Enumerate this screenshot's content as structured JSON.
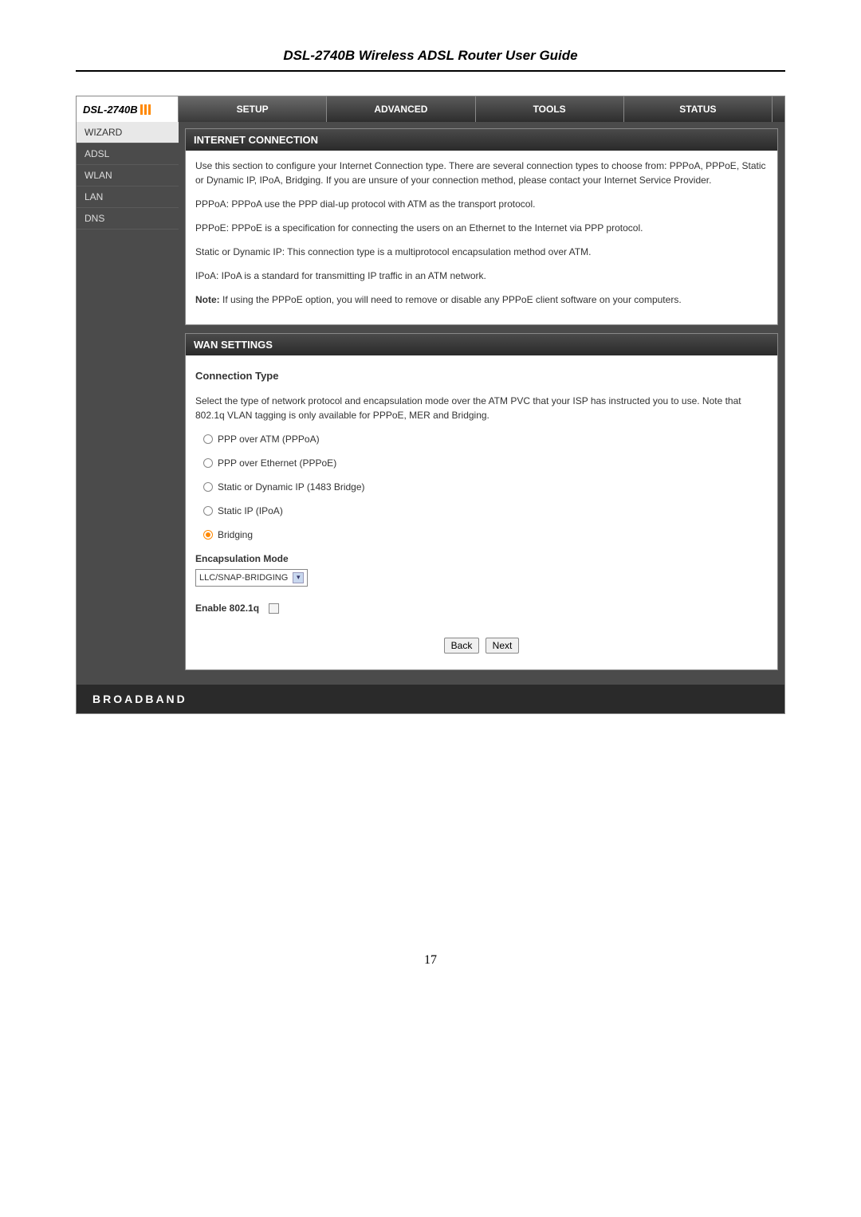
{
  "docHeader": "DSL-2740B Wireless ADSL Router User Guide",
  "logo": "DSL-2740B",
  "tabs": [
    "SETUP",
    "ADVANCED",
    "TOOLS",
    "STATUS"
  ],
  "sidebar": [
    "WIZARD",
    "ADSL",
    "WLAN",
    "LAN",
    "DNS"
  ],
  "panel1": {
    "title": "INTERNET CONNECTION",
    "intro": "Use this section to configure your Internet Connection type. There are several connection types to choose from: PPPoA, PPPoE, Static or Dynamic IP, IPoA, Bridging. If you are unsure of your connection method, please contact your Internet Service Provider.",
    "p1": "PPPoA: PPPoA use the PPP dial-up protocol with ATM as the transport protocol.",
    "p2": "PPPoE: PPPoE is a specification for connecting the users on an Ethernet to the Internet via PPP protocol.",
    "p3": "Static or Dynamic IP: This connection type is a multiprotocol encapsulation method over ATM.",
    "p4": "IPoA: IPoA is a standard for transmitting IP traffic in an ATM network.",
    "noteLabel": "Note:",
    "noteText": " If using the PPPoE option, you will need to remove or disable any PPPoE client software on your computers."
  },
  "panel2": {
    "title": "WAN SETTINGS",
    "connTypeHeading": "Connection Type",
    "connTypeDesc": "Select the type of network protocol and encapsulation mode over the ATM PVC that your ISP has instructed you to use. Note that 802.1q VLAN tagging is only available for PPPoE, MER and Bridging.",
    "radios": [
      "PPP over ATM (PPPoA)",
      "PPP over Ethernet (PPPoE)",
      "Static or Dynamic IP (1483 Bridge)",
      "Static IP (IPoA)",
      "Bridging"
    ],
    "selectedRadio": 4,
    "encapLabel": "Encapsulation Mode",
    "encapValue": "LLC/SNAP-BRIDGING",
    "enable8021q": "Enable 802.1q",
    "backBtn": "Back",
    "nextBtn": "Next"
  },
  "footer": "BROADBAND",
  "pageNumber": "17"
}
